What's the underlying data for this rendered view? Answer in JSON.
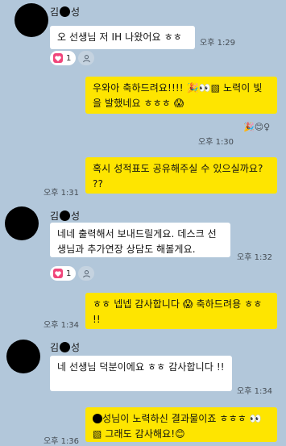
{
  "sender_name_start": "김",
  "sender_name_end": "성",
  "messages": [
    {
      "text": "오 선생님 저 IH 나왔어요 ㅎㅎ",
      "time": "오후 1:29",
      "reaction_count": "1"
    },
    {
      "text": "우와아 축하드려요!!!! 🎉👀▧ 노력이 빛을 발했네요 ㅎㅎㅎ 😱",
      "time": "오후 1:30",
      "after_text": "🎉😊♀"
    },
    {
      "text": "혹시 성적표도 공유해주실 수 있으실까요? ??",
      "time": "오후 1:31"
    },
    {
      "text": "네네 출력해서 보내드릴게요. 데스크 선생님과 추가연장 상담도 해볼게요.",
      "time": "오후 1:32",
      "reaction_count": "1"
    },
    {
      "text": "ㅎㅎ 넵넵 감사합니다 😱 축하드려용 ㅎㅎ !!",
      "time": "오후 1:34"
    },
    {
      "text": "네 선생님 덕분이에요 ㅎㅎ 감사합니다 !!",
      "time": "오후 1:34"
    },
    {
      "text_end": "성님이 노력하신 결과물이죠 ㅎㅎㅎ 👀 ▧ 그래도 감사해요!😊",
      "time": "오후 1:36"
    }
  ],
  "colors": {
    "background": "#b2c7da",
    "outgoing": "#fee500",
    "incoming": "#ffffff",
    "heart": "#f0467b"
  },
  "icons": {
    "reaction": "heart-icon",
    "add_reaction": "person-icon"
  }
}
